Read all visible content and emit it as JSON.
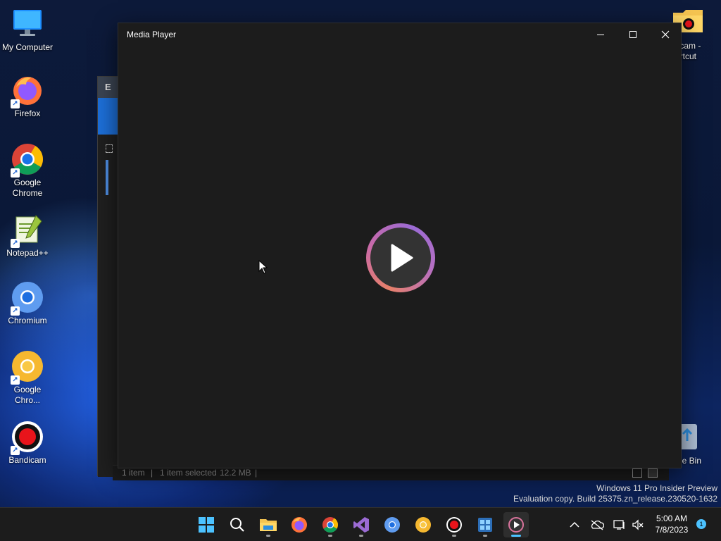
{
  "desktop": {
    "icons": [
      {
        "label": "My Computer"
      },
      {
        "label": "Firefox"
      },
      {
        "label": "Google Chrome"
      },
      {
        "label": "Notepad++"
      },
      {
        "label": "Chromium"
      },
      {
        "label": "Google Chro..."
      },
      {
        "label": "Bandicam"
      }
    ],
    "right_icons": {
      "bandicam_shortcut_line1": "dicam -",
      "bandicam_shortcut_line2": "ortcut",
      "recycle_bin": "cle Bin"
    }
  },
  "background_window": {
    "title_fragment": "E"
  },
  "media_player": {
    "title": "Media Player",
    "play_button_icon": "play-icon"
  },
  "explorer_status": {
    "items": "1 item",
    "selected": "1 item selected",
    "size": "12.2 MB",
    "sep1": "|",
    "sep2": "|"
  },
  "watermark": {
    "line1": "Windows 11 Pro Insider Preview",
    "line2": "Evaluation copy. Build 25375.zn_release.230520-1632"
  },
  "taskbar": {
    "apps": [
      {
        "name": "start"
      },
      {
        "name": "search"
      },
      {
        "name": "file-explorer"
      },
      {
        "name": "firefox"
      },
      {
        "name": "chrome"
      },
      {
        "name": "visual-studio"
      },
      {
        "name": "chromium"
      },
      {
        "name": "chrome-canary"
      },
      {
        "name": "bandicam"
      },
      {
        "name": "windows-app"
      },
      {
        "name": "media-player"
      }
    ],
    "clock": {
      "time": "5:00 AM",
      "date": "7/8/2023"
    },
    "notification_count": "1"
  },
  "colors": {
    "accent": "#4cc2ff",
    "window_bg": "#1c1c1c",
    "taskbar_bg": "#1c1c1c"
  }
}
